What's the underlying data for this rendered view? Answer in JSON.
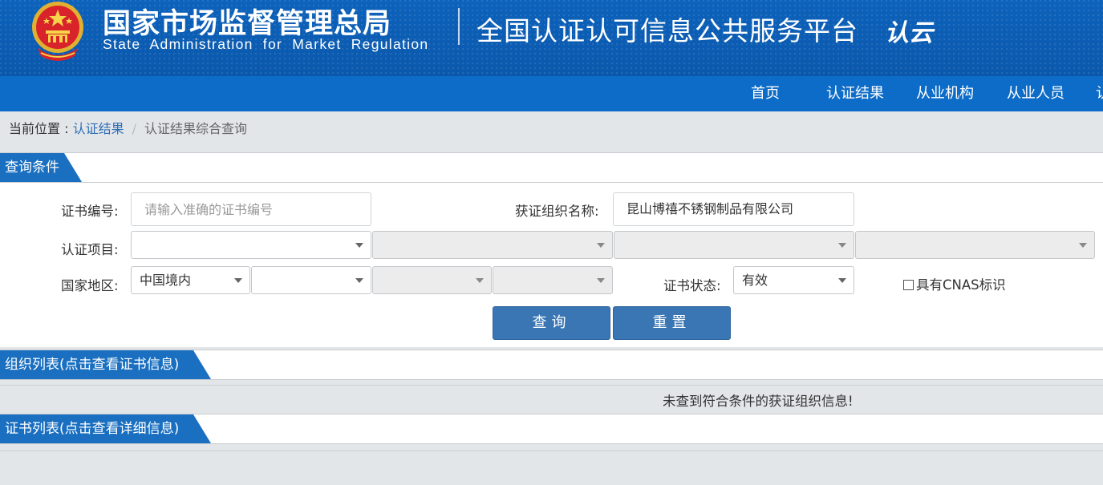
{
  "header": {
    "agency_name_cn": "国家市场监督管理总局",
    "agency_name_en": "State Administration  for  Market Regulation",
    "platform_title": "全国认证认可信息公共服务平台",
    "logo_text": "认云"
  },
  "nav": {
    "items": [
      {
        "label": "首页"
      },
      {
        "label": "认证结果"
      },
      {
        "label": "从业机构"
      },
      {
        "label": "从业人员"
      },
      {
        "label": "认"
      }
    ]
  },
  "breadcrumb": {
    "prefix": "当前位置 : ",
    "link": "认证结果",
    "separator": "/",
    "current": "认证结果综合查询"
  },
  "query_section": {
    "title": "查询条件",
    "cert_number_label": "证书编号:",
    "cert_number_placeholder": "请输入准确的证书编号",
    "cert_number_value": "",
    "org_name_label": "获证组织名称:",
    "org_name_value": "昆山博禧不锈钢制品有限公司",
    "cert_project_label": "认证项目:",
    "cert_project_selects": [
      "",
      "",
      "",
      ""
    ],
    "region_label": "国家地区:",
    "region_selects": [
      "中国境内",
      "",
      "",
      ""
    ],
    "cert_status_label": "证书状态:",
    "cert_status_value": "有效",
    "cnas_label": "具有CNAS标识",
    "cnas_checked": false,
    "search_button": "查询",
    "reset_button": "重置"
  },
  "org_list": {
    "title": "组织列表(点击查看证书信息)",
    "empty_message": "未查到符合条件的获证组织信息!"
  },
  "cert_list": {
    "title": "证书列表(点击查看详细信息)"
  },
  "colors": {
    "header_bg": "#0b5db5",
    "nav_bg": "#0d6cc8",
    "section_tab_bg": "#1a6fc0",
    "button_bg": "#3a76b3",
    "page_bg": "#e3e6e9",
    "link": "#2f6fb4"
  }
}
